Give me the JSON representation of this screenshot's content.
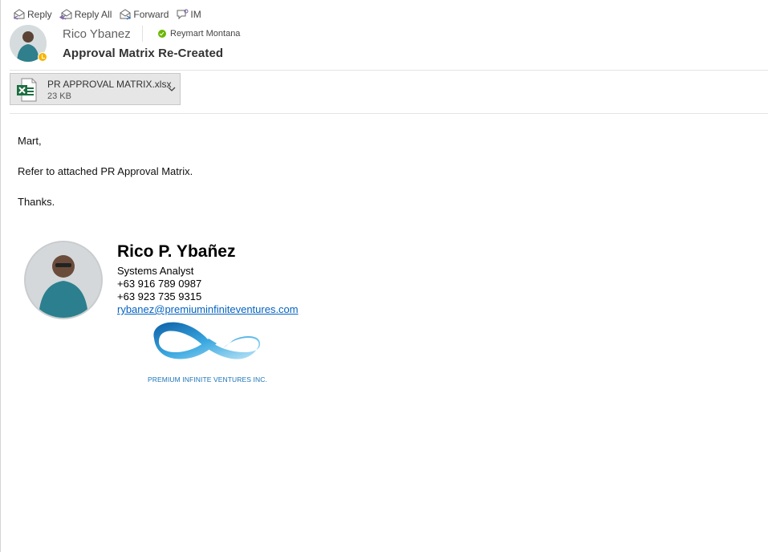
{
  "toolbar": {
    "reply": "Reply",
    "reply_all": "Reply All",
    "forward": "Forward",
    "im": "IM"
  },
  "message": {
    "sender": "Rico Ybanez",
    "recipient": "Reymart Montana",
    "subject": "Approval Matrix Re-Created"
  },
  "attachment": {
    "name": "PR APPROVAL MATRIX.xlsx",
    "size": "23 KB"
  },
  "body": {
    "greeting": "Mart,",
    "line1": "Refer to attached PR Approval Matrix.",
    "closing": "Thanks."
  },
  "signature": {
    "name": "Rico P. Ybañez",
    "title": "Systems Analyst",
    "phone1": "+63 916 789 0987",
    "phone2": "+63 923 735 9315",
    "email": "rybanez@premiuminfiniteventures.com",
    "company": "PREMIUM INFINITE VENTURES INC."
  },
  "colors": {
    "presence_away": "#f7b500",
    "presence_available": "#6bb700",
    "excel_green": "#1d6f42",
    "link_blue": "#0563c1",
    "logo_blue": "#1b74b8"
  }
}
